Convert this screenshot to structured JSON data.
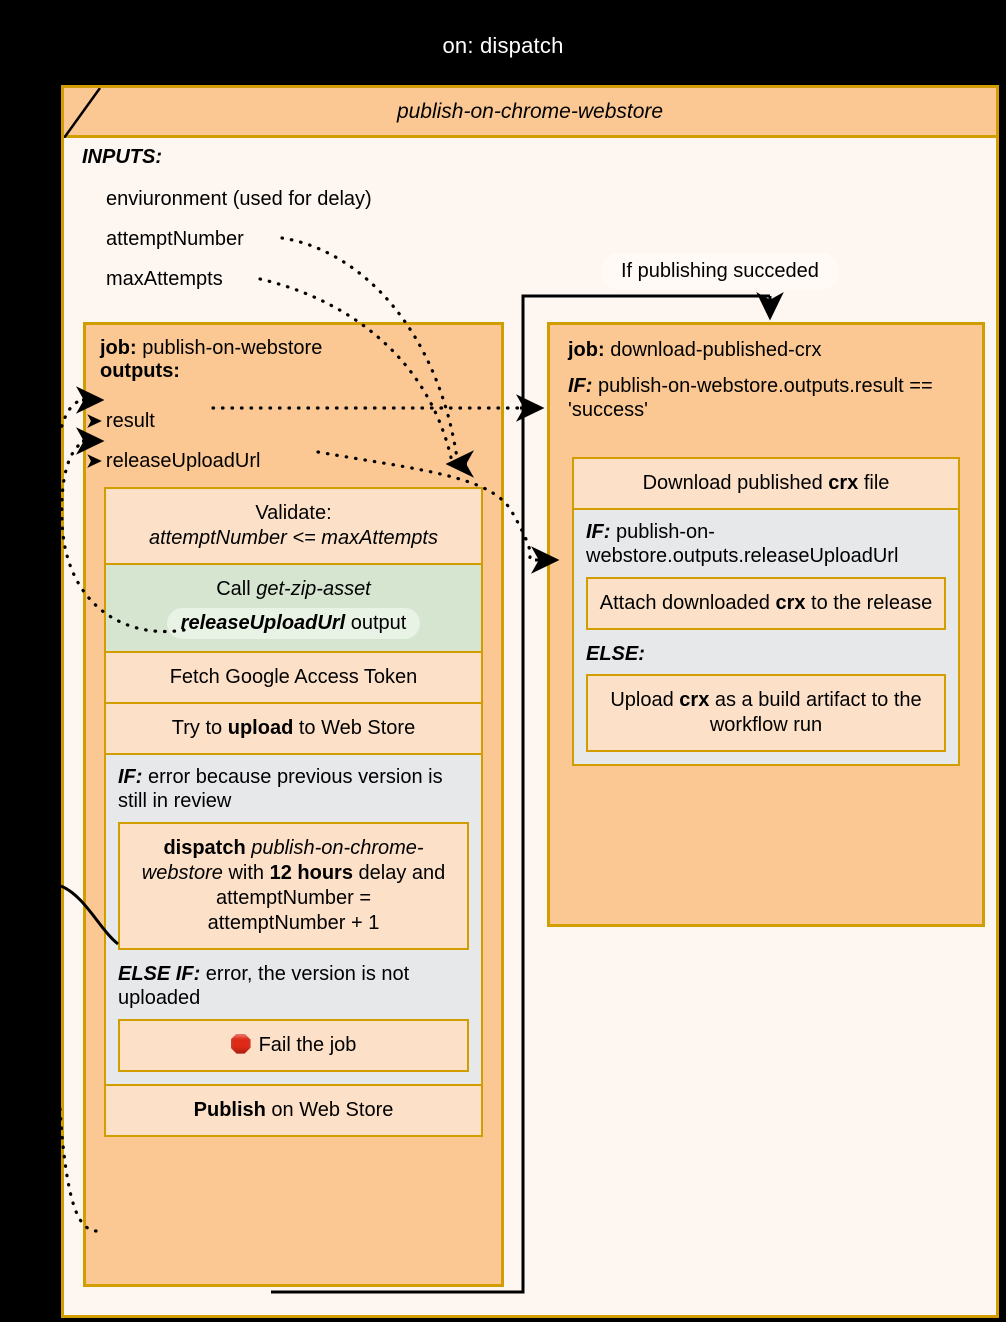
{
  "trigger": {
    "label": "on: dispatch"
  },
  "workflow": {
    "title": "publish-on-chrome-webstore",
    "inputs_heading": "INPUTS:",
    "inputs": [
      "enviuronment (used for delay)",
      "attemptNumber",
      "maxAttempts"
    ]
  },
  "edge_labels": {
    "publish_succeeded": "If publishing succeded"
  },
  "jobs": {
    "left": {
      "title_prefix": "job:",
      "title_name": "publish-on-webstore",
      "outputs_heading": "outputs:",
      "outputs": [
        {
          "arrow": "➤",
          "name": "result"
        },
        {
          "arrow": "➤",
          "name": "releaseUploadUrl"
        }
      ],
      "steps": [
        {
          "line1": "Validate:",
          "line2": "attemptNumber <= maxAttempts"
        },
        {
          "line1": "Call ",
          "line1_em": "get-zip-asset",
          "pill_bold": "releaseUploadUrl",
          "pill_rest": " output"
        },
        {
          "text": "Fetch Google Access Token"
        },
        {
          "pre": "Try to ",
          "bold": "upload",
          "post": " to Web Store"
        }
      ],
      "conditional": {
        "if_label_kw": "IF:",
        "if_label_text": " error because previous version is still in review",
        "if_step": {
          "bold1": "dispatch",
          "em1": " publish-on-chrome-webstore",
          "mid": " with ",
          "bold2": "12 hours",
          "post": " delay and",
          "line3": "attemptNumber =",
          "line4": "attemptNumber + 1"
        },
        "elseif_label_kw": "ELSE IF:",
        "elseif_label_text": " error, the version is not uploaded",
        "elseif_step": {
          "icon": "stop-octagon",
          "text": "Fail the job"
        }
      },
      "final_step": {
        "bold": "Publish",
        "post": " on Web Store"
      }
    },
    "right": {
      "title_prefix": "job:",
      "title_name": "download-published-crx",
      "if_kw": "IF:",
      "if_text": " publish-on-webstore.outputs.result ==  'success'",
      "steps": [
        {
          "pre": "Download published ",
          "bold": "crx",
          "post": " file"
        }
      ],
      "conditional": {
        "if_label_kw": "IF:",
        "if_label_text": " publish-on-webstore.outputs.releaseUploadUrl",
        "if_step": {
          "pre": "Attach downloaded ",
          "bold": "crx",
          "post": " to the release"
        },
        "else_label_kw": "ELSE:",
        "else_step": {
          "pre": "Upload ",
          "bold": "crx",
          "post": " as a build artifact to the workflow run"
        }
      }
    }
  },
  "colors": {
    "canvas": "#000000",
    "frame_border": "#d29d00",
    "frame_body": "#fdf6f1",
    "header_fill": "#fbc893",
    "job_fill": "#fbc893",
    "step_fill": "#fce0c8",
    "step_green_fill": "#d5e5d0",
    "pill_green_fill": "#e9f3e5",
    "conditional_fill": "#e7e8ea",
    "stop_red": "#e02a18",
    "edge_stroke": "#000000"
  }
}
